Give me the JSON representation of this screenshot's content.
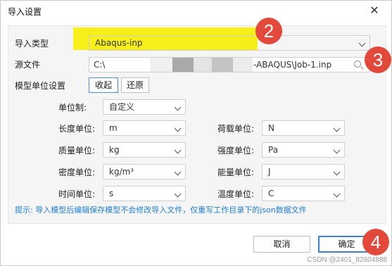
{
  "window": {
    "title": "导入设置",
    "close_glyph": "✕"
  },
  "import_type": {
    "label": "导入类型",
    "value": "Abaqus-inp"
  },
  "source_file": {
    "label": "源文件",
    "value_start": "C:\\",
    "value_end": "-ABAQUS\\Job-1.inp",
    "icon": "search-icon"
  },
  "model_units": {
    "label": "模型单位设置",
    "collapse_label": "收起",
    "restore_label": "还原"
  },
  "units": {
    "unit_system": {
      "label": "单位制:",
      "value": "自定义"
    },
    "length": {
      "label": "长度单位:",
      "value": "m"
    },
    "load": {
      "label": "荷载单位:",
      "value": "N"
    },
    "mass": {
      "label": "质量单位:",
      "value": "kg"
    },
    "strength": {
      "label": "强度单位:",
      "value": "Pa"
    },
    "density": {
      "label": "密度单位:",
      "value": "kg/m³"
    },
    "energy": {
      "label": "能量单位:",
      "value": "J"
    },
    "time": {
      "label": "时间单位:",
      "value": "s"
    },
    "temperature": {
      "label": "温度单位:",
      "value": "C"
    }
  },
  "hint": "提示: 导入模型后编辑保存模型不会修改导入文件，仅重写工作目录下的json数据文件",
  "buttons": {
    "cancel": "取消",
    "ok": "确定"
  },
  "markers": [
    "2",
    "3",
    "4"
  ],
  "watermark": "CSDN @2401_82604888",
  "colors": {
    "accent": "#3b82d6",
    "hint": "#1f7fd8",
    "highlight": "#f7f000",
    "marker": "#e3493b"
  }
}
